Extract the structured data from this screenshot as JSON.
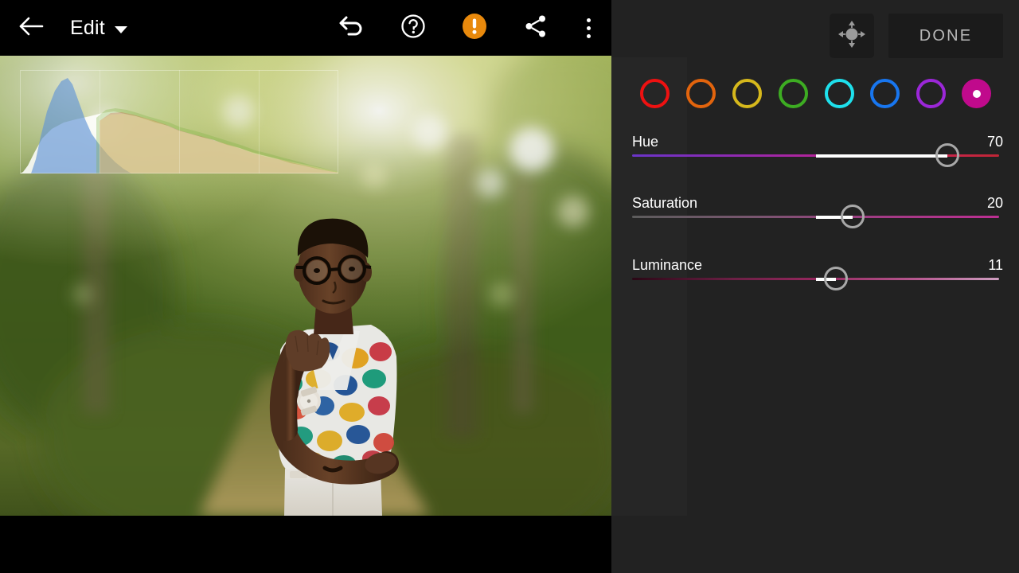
{
  "app": {
    "name": "photo-editor",
    "background_color": "#000000",
    "panel_color": "#222222"
  },
  "toolbar": {
    "back_icon": "back-arrow-icon",
    "title": "Edit",
    "dropdown_icon": "chevron-down-icon",
    "undo_icon": "undo-icon",
    "help_icon": "help-circle-icon",
    "alert_icon": "alert-exclamation-icon",
    "alert_color": "#e8890c",
    "share_icon": "share-icon",
    "more_icon": "more-vertical-icon"
  },
  "panel": {
    "pan_tool_icon": "move-pan-icon",
    "done_label": "DONE"
  },
  "color_swatches": {
    "selected_index": 7,
    "items": [
      {
        "name": "red",
        "color": "#ee1111",
        "selected": false
      },
      {
        "name": "orange",
        "color": "#e2640d",
        "selected": false
      },
      {
        "name": "yellow",
        "color": "#d6b81c",
        "selected": false
      },
      {
        "name": "green",
        "color": "#3dac22",
        "selected": false
      },
      {
        "name": "cyan",
        "color": "#1ee0ec",
        "selected": false
      },
      {
        "name": "blue",
        "color": "#1876ef",
        "selected": false
      },
      {
        "name": "purple",
        "color": "#9b27d8",
        "selected": false
      },
      {
        "name": "magenta",
        "color": "#c00a8c",
        "selected": true
      }
    ]
  },
  "sliders": [
    {
      "name": "hue",
      "label": "Hue",
      "value": 70,
      "value_text": "70",
      "thumb_pct": 86.0,
      "center_pct": 50.0,
      "gradient": "linear-gradient(to right, #6a34c8 0%, #8b2bb4 25%, #b2249a 50%, #c4237f 62%, #c9254f 82%, #c02535 100%)"
    },
    {
      "name": "saturation",
      "label": "Saturation",
      "value": 20,
      "value_text": "20",
      "thumb_pct": 60.0,
      "center_pct": 50.0,
      "gradient": "linear-gradient(to right, #5c5c5c 0%, #7a5570 35%, #a03c84 65%, #bd2f93 100%)"
    },
    {
      "name": "luminance",
      "label": "Luminance",
      "value": 11,
      "value_text": "11",
      "thumb_pct": 55.5,
      "center_pct": 50.0,
      "gradient": "linear-gradient(to right, #2a0715 0%, #6d2046 28%, #95275e 50%, #b85a92 78%, #cf9ec0 100%)"
    }
  ],
  "histogram": {
    "name": "rgb-histogram-overlay",
    "grid_divisions": 4,
    "channels": [
      "red",
      "green",
      "blue",
      "luminance"
    ],
    "blue_peak_x": 0.17,
    "luma_peak_x": 0.22
  },
  "photo": {
    "description": "portrait of a person in a colorful floral shirt and white trousers on a forest path",
    "visible": true
  }
}
